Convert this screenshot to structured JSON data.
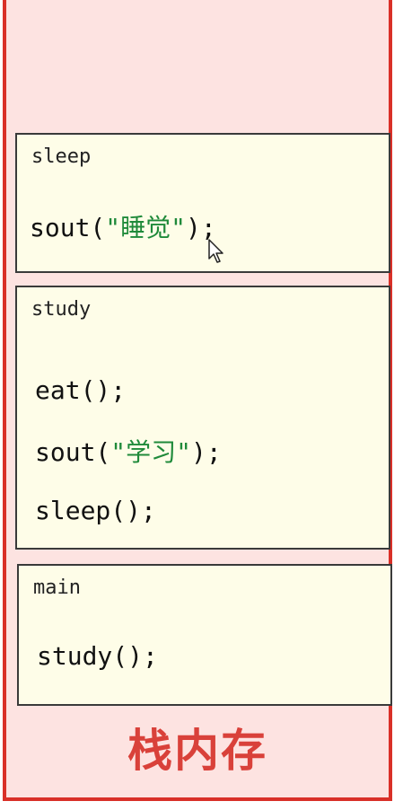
{
  "stack": {
    "label": "栈内存",
    "accent_color": "#d93028",
    "frames": [
      {
        "name": "sleep",
        "lines": [
          {
            "pre": "sout(",
            "str": "\"睡觉\"",
            "post": ");"
          }
        ]
      },
      {
        "name": "study",
        "lines": [
          {
            "pre": "eat();",
            "str": "",
            "post": ""
          },
          {
            "pre": "sout(",
            "str": "\"学习\"",
            "post": ");"
          },
          {
            "pre": "sleep();",
            "str": "",
            "post": ""
          }
        ]
      },
      {
        "name": "main",
        "lines": [
          {
            "pre": "study();",
            "str": "",
            "post": ""
          }
        ]
      }
    ]
  },
  "cursor_icon": "mouse-pointer-icon"
}
